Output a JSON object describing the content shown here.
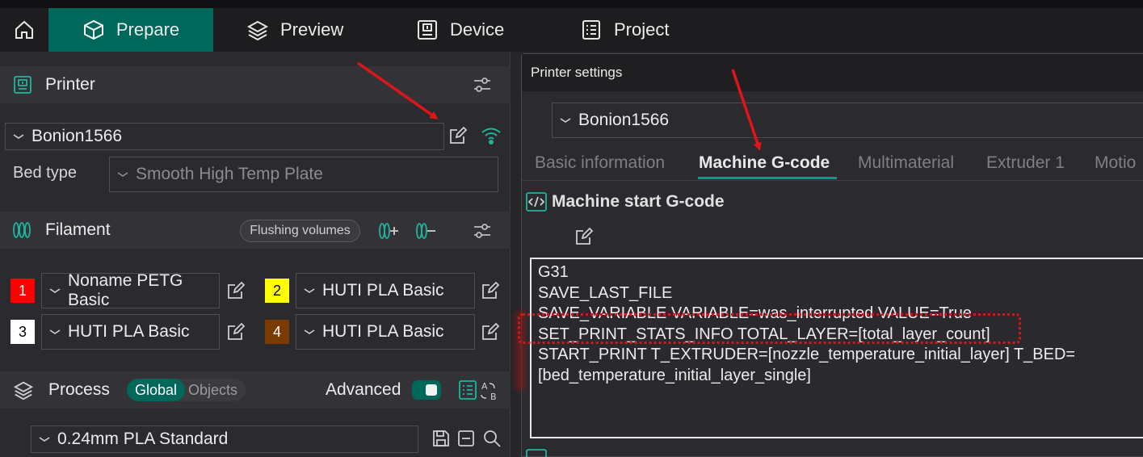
{
  "nav": {
    "tabs": [
      {
        "label": "Prepare",
        "icon": "cube-icon",
        "active": true
      },
      {
        "label": "Preview",
        "icon": "layers-icon",
        "active": false
      },
      {
        "label": "Device",
        "icon": "device-icon",
        "active": false
      },
      {
        "label": "Project",
        "icon": "list-icon",
        "active": false
      }
    ]
  },
  "printer": {
    "title": "Printer",
    "selected": "Bonion1566",
    "bed_type_label": "Bed type",
    "bed_type_value": "Smooth High Temp Plate"
  },
  "filament": {
    "title": "Filament",
    "flushing_label": "Flushing volumes",
    "slots": [
      {
        "num": "1",
        "name": "Noname PETG Basic",
        "color": "#ff0000",
        "text_color": "#ffffff"
      },
      {
        "num": "2",
        "name": "HUTI PLA Basic",
        "color": "#ffff00",
        "text_color": "#000000"
      },
      {
        "num": "3",
        "name": "HUTI PLA Basic",
        "color": "#ffffff",
        "text_color": "#000000"
      },
      {
        "num": "4",
        "name": "HUTI PLA Basic",
        "color": "#7a3a00",
        "text_color": "#ffffff"
      }
    ]
  },
  "process": {
    "title": "Process",
    "global_label": "Global",
    "objects_label": "Objects",
    "advanced_label": "Advanced",
    "advanced_on": true,
    "preset": "0.24mm PLA Standard"
  },
  "printer_settings": {
    "title": "Printer settings",
    "selected": "Bonion1566",
    "tabs": [
      "Basic information",
      "Machine G-code",
      "Multimaterial",
      "Extruder 1",
      "Motio"
    ],
    "active_tab": "Machine G-code",
    "section_title": "Machine start G-code",
    "gcode_lines": [
      "G31",
      "SAVE_LAST_FILE",
      "SAVE_VARIABLE VARIABLE=was_interrupted VALUE=True",
      "SET_PRINT_STATS_INFO TOTAL_LAYER=[total_layer_count]",
      "START_PRINT T_EXTRUDER=[nozzle_temperature_initial_layer] T_BED=",
      "[bed_temperature_initial_layer_single]"
    ]
  },
  "colors": {
    "accent": "#00675b",
    "accent_bright": "#00a08c",
    "annotation": "#e0151a"
  }
}
